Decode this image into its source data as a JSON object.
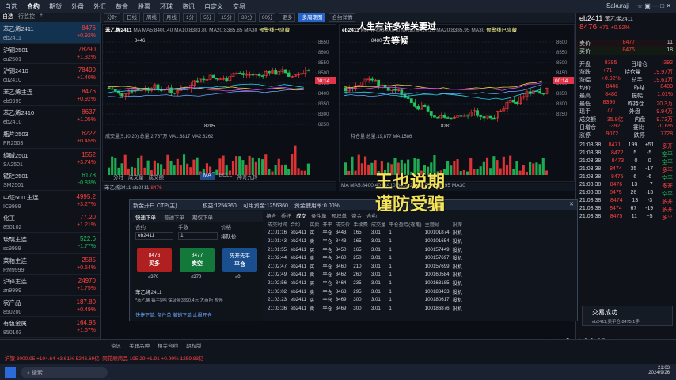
{
  "topbar": {
    "items": [
      "自选",
      "合约",
      "期货",
      "外盘",
      "外汇",
      "黄金",
      "股票",
      "环球",
      "资讯",
      "自定义",
      "交易"
    ],
    "user": "Sakuraji",
    "right_icons": "☆ ▣ — □ ✕"
  },
  "sidebar": {
    "tabs": [
      "自选",
      "行监控",
      "+"
    ],
    "items": [
      {
        "name": "苯乙烯2411",
        "code": "eb2411",
        "price": "8476",
        "change": "+0.92%",
        "dir": "up",
        "selected": true
      },
      {
        "name": "沪铜2501",
        "code": "cu2501",
        "price": "78290",
        "change": "+1.32%",
        "dir": "up"
      },
      {
        "name": "沪铜2410",
        "code": "cu2410",
        "price": "78490",
        "change": "+1.40%",
        "dir": "up"
      },
      {
        "name": "苯乙烯主连",
        "code": "eb9999",
        "price": "8476",
        "change": "+0.92%",
        "dir": "up"
      },
      {
        "name": "苯乙烯2410",
        "code": "eb2410",
        "price": "8637",
        "change": "+1.05%",
        "dir": "up"
      },
      {
        "name": "瓶片2503",
        "code": "PR2503",
        "price": "6222",
        "change": "+0.45%",
        "dir": "up"
      },
      {
        "name": "纯碱2501",
        "code": "SA2501",
        "price": "1552",
        "change": "+3.74%",
        "dir": "up"
      },
      {
        "name": "锰硅2501",
        "code": "SM2501",
        "price": "6178",
        "change": "-0.83%",
        "dir": "dn"
      },
      {
        "name": "中证500 主连",
        "code": "IC9999",
        "price": "4995.2",
        "change": "+3.27%",
        "dir": "up"
      },
      {
        "name": "化工",
        "code": "850102",
        "price": "77.20",
        "change": "+1.21%",
        "dir": "up"
      },
      {
        "name": "玻璃主连",
        "code": "sc9999",
        "price": "522.6",
        "change": "-1.77%",
        "dir": "dn"
      },
      {
        "name": "菜粕主连",
        "code": "RM9999",
        "price": "2585",
        "change": "+0.54%",
        "dir": "up"
      },
      {
        "name": "沪锌主连",
        "code": "zn9999",
        "price": "24970",
        "change": "+1.75%",
        "dir": "up"
      },
      {
        "name": "农产品",
        "code": "850200",
        "price": "187.80",
        "change": "+0.49%",
        "dir": "up"
      },
      {
        "name": "有色金属",
        "code": "850103",
        "price": "164.95",
        "change": "+1.67%",
        "dir": "up"
      }
    ]
  },
  "toolbar2": [
    "分时",
    "日线",
    "周线",
    "月线",
    "1分",
    "5分",
    "15分",
    "30分",
    "60分",
    "更多",
    "多周期图",
    "合约详情"
  ],
  "charts": {
    "left_title": "苯乙烯2411",
    "left_ma": "MA MA5:8400.40  MA10:8383.80  MA20:8385.85  MA30",
    "left_tag": "预警线已隐藏",
    "left_labels": {
      "hi": "8446",
      "lo": "8285",
      "mid": "8300",
      "a": "8316",
      "b": "8460",
      "cur": "00:14"
    },
    "left_vol": "成交量(5,10,20)  总量:2.767万  MA1:8817  MA2:8262",
    "left_dates": [
      "2024/09",
      "09/26"
    ],
    "left_axis": [
      "8650",
      "8600",
      "8550",
      "8500",
      "8450",
      "8400",
      "8350",
      "8300",
      "8250"
    ],
    "right_title": "eb2411",
    "right_ma": "MA MA5:8400.40 MA10:8410.20 MA20:8385.95  MA30",
    "right_tag": "预警线已隐藏",
    "right_labels": {
      "hi": "8480",
      "lo": "8281",
      "mid": "8371",
      "cur": "00:14"
    },
    "right_vol": "持仓量  总量:19,877  MA:1586",
    "right_dates": [
      "2024/09",
      "09/26"
    ],
    "right_axis": [
      "8600",
      "8550",
      "8500",
      "8450",
      "8400",
      "8350",
      "8300",
      "8250"
    ],
    "overlay1": "人生有许多难关要过",
    "overlay2": "去等候"
  },
  "small_tabs": [
    "分时",
    "成交量",
    "成交额",
    "MA",
    "BOLL",
    "神奇九转",
    "持仓量",
    "MACD",
    "RSI",
    "KDJ"
  ],
  "quote": {
    "name": "苯乙烯2411",
    "price": "8476",
    "chg": "+71",
    "pct": "+0.92%",
    "ask_label": "卖价",
    "ask": "8477",
    "ask_vol": "11",
    "bid_label": "买价",
    "bid": "8476",
    "bid_vol": "18",
    "stats": [
      [
        "开盘",
        "8395",
        "日增仓",
        "-392"
      ],
      [
        "涨跌",
        "+71",
        "持仓量",
        "19.97万"
      ],
      [
        "涨幅",
        "+0.92%",
        "总手",
        "19.61万"
      ],
      [
        "均价",
        "8446",
        "昨结",
        "8400"
      ],
      [
        "最高",
        "8480",
        "振幅",
        "1.01%"
      ],
      [
        "最低",
        "8396",
        "昨持仓",
        "20.3万"
      ],
      [
        "现手",
        "77",
        "外盘",
        "9.94万"
      ],
      [
        "成交额",
        "35.9亿",
        "内盘",
        "9.73万"
      ],
      [
        "日增仓",
        "-392",
        "委比",
        "70.6%"
      ],
      [
        "涨停",
        "9072",
        "跌停",
        "7728"
      ]
    ],
    "trades": [
      [
        "21:03:38",
        "8471",
        "199",
        "+51",
        "多开"
      ],
      [
        "21:03:38",
        "8472",
        "5",
        "-5",
        "空平"
      ],
      [
        "21:03:38",
        "8473",
        "0",
        "0",
        "空平"
      ],
      [
        "21:03:38",
        "8474",
        "35",
        "-17",
        "多平"
      ],
      [
        "21:03:38",
        "8475",
        "6",
        "-6",
        "空平"
      ],
      [
        "21:03:38",
        "8476",
        "13",
        "+7",
        "多开"
      ],
      [
        "21:03:38",
        "8475",
        "26",
        "-13",
        "空平"
      ],
      [
        "21:03:38",
        "8474",
        "13",
        "-3",
        "多开"
      ],
      [
        "21:03:38",
        "8474",
        "67",
        "-19",
        "多开"
      ],
      [
        "21:03:38",
        "8475",
        "11",
        "+5",
        "多平"
      ]
    ]
  },
  "dialog": {
    "title": "新金开户 CTP(主)",
    "balance_label": "权益:",
    "balance": "1256360",
    "avail_label": "可用资金:",
    "avail": "1256360",
    "ratio_label": "资金使用率:",
    "ratio": "0.00%",
    "tabs": [
      "持合",
      "委托",
      "成交",
      "条件单",
      "预埋单",
      "资金",
      "合约"
    ],
    "order_tabs": [
      "快速下单",
      "普通下单",
      "期权下单"
    ],
    "contract_label": "合约",
    "contract": "eb2411",
    "qty_label": "手数",
    "qty": "1",
    "price_label": "价格",
    "price": "排队价",
    "buy_label": "买多",
    "buy_price": "8476",
    "sell_label": "卖空",
    "sell_price": "8477",
    "close_label": "平仓",
    "close_price": "先开先平",
    "buy_sub": "≤370",
    "sell_sub": "≤370",
    "close_sub": "≤0",
    "info_name": "苯乙烯2411",
    "info_line": "*苯乙烯 每手5吨 保证金3390.4元 大商所 暂停",
    "quick": "快捷下单:  条件单  撤销下单  止损开仓",
    "table_head": [
      "成交时间",
      "合约",
      "买卖",
      "开平",
      "成交价",
      "手续费",
      "成交量",
      "平仓盈亏(逐笔)",
      "主题号",
      "投保"
    ],
    "rows": [
      [
        "21:01:16",
        "eb2411",
        "买",
        "平仓",
        "8443",
        "165",
        "3.01",
        "1",
        "100101874",
        "投机"
      ],
      [
        "21:01:43",
        "eb2411",
        "卖",
        "平仓",
        "8443",
        "165",
        "3.01",
        "1",
        "100101654",
        "投机"
      ],
      [
        "21:01:55",
        "eb2411",
        "买",
        "平仓",
        "8450",
        "165",
        "3.01",
        "1",
        "100157449",
        "投机"
      ],
      [
        "21:02:44",
        "eb2411",
        "卖",
        "平仓",
        "8460",
        "250",
        "3.01",
        "1",
        "100157697",
        "投机"
      ],
      [
        "21:02:47",
        "eb2411",
        "买",
        "平仓",
        "8460",
        "210",
        "3.01",
        "1",
        "100157699",
        "投机"
      ],
      [
        "21:02:49",
        "eb2411",
        "卖",
        "平仓",
        "8462",
        "260",
        "3.01",
        "1",
        "100160584",
        "投机"
      ],
      [
        "21:02:56",
        "eb2411",
        "买",
        "平仓",
        "8464",
        "235",
        "3.01",
        "1",
        "100163185",
        "投机"
      ],
      [
        "21:03:02",
        "eb2411",
        "卖",
        "平仓",
        "8468",
        "295",
        "3.01",
        "1",
        "100188433",
        "投机"
      ],
      [
        "21:03:23",
        "eb2411",
        "买",
        "平仓",
        "8469",
        "300",
        "3.01",
        "1",
        "100180617",
        "投机"
      ],
      [
        "21:03:36",
        "eb2411",
        "卖",
        "平仓",
        "8469",
        "300",
        "3.01",
        "1",
        "100186876",
        "投机"
      ]
    ]
  },
  "bottombar": {
    "tabs": [
      "资讯",
      "关联品种",
      "相关合约",
      "期权版"
    ],
    "index": "沪银  3000.95  +104.64  +3.61%  5246.69亿",
    "index2": "同花顺商品  195.29  +1.91  +0.99%  1259.83亿"
  },
  "taskbar": {
    "search": "搜索",
    "time": "21:03",
    "date": "2024/9/26"
  },
  "overlays": {
    "wang1": "王也说期",
    "wang2": "谨防受骗",
    "handle": "@王也说期",
    "toast": "交易成功",
    "toast_sub": "eb2411,卖平仓,8475,1手"
  }
}
